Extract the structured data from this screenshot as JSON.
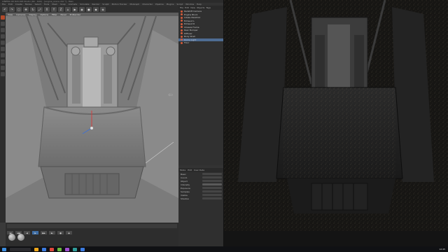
{
  "window": {
    "title": "CINEMA 4D R20.026 Studio (RC - R20) - [engine_scene.c4d *] - Main"
  },
  "menubar": [
    "File",
    "Edit",
    "Create",
    "Modes",
    "Select",
    "Tools",
    "Mesh",
    "Snap",
    "Animate",
    "Simulate",
    "Render",
    "Sculpt",
    "Motion Tracker",
    "MoGraph",
    "Character",
    "Pipeline",
    "Plugins",
    "Script",
    "Window",
    "Help"
  ],
  "toolbar": {
    "buttons": [
      "↶",
      "↷",
      "▢",
      "✥",
      "↻",
      "⤢",
      "X",
      "Y",
      "Z",
      "⌂",
      "▶",
      "◉",
      "●",
      "◆",
      "◈"
    ]
  },
  "viewport": {
    "menu": [
      "View",
      "Cameras",
      "Display",
      "Options",
      "Filter",
      "Panel",
      "ProRender"
    ],
    "label": "Perspective"
  },
  "object_manager": {
    "tabs": [
      "File",
      "Edit",
      "View",
      "Objects",
      "Tags"
    ],
    "rows": [
      {
        "name": "Redshift Camera"
      },
      {
        "name": "Engine Block"
      },
      {
        "name": "Intake Manifold"
      },
      {
        "name": "Exhaust L"
      },
      {
        "name": "Exhaust R"
      },
      {
        "name": "Chassis Frame"
      },
      {
        "name": "Rear Bumper"
      },
      {
        "name": "Diffuser"
      },
      {
        "name": "Body Shell"
      },
      {
        "name": "Dome Light"
      },
      {
        "name": "Floor"
      }
    ],
    "selected_index": 9
  },
  "attributes": {
    "tabs": [
      "Mode",
      "Edit",
      "User Data"
    ],
    "rows": [
      "Basic",
      "Coord.",
      "Object",
      "Intensity",
      "Exposure",
      "Samples",
      "Visible",
      "Shadow"
    ]
  },
  "timeline": {
    "buttons": [
      "|◀",
      "◀◀",
      "◀",
      "▶",
      "▶▶",
      "▶|",
      "●",
      "◆"
    ],
    "frame": "0 F"
  },
  "taskbar": {
    "clock": "12:45"
  }
}
